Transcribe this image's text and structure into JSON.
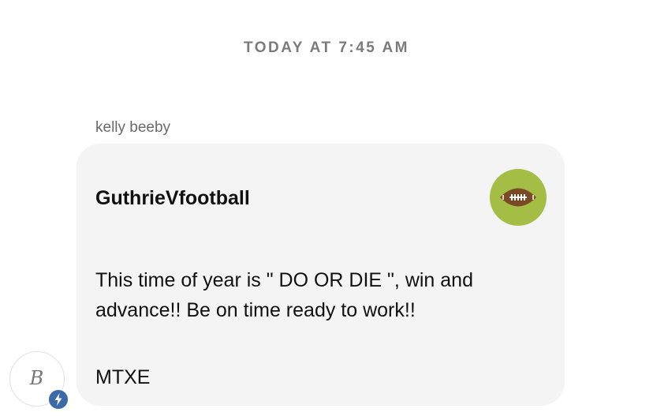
{
  "timestamp": "TODAY AT 7:45 AM",
  "message": {
    "sender": "kelly beeby",
    "group_name": "GuthrieVfootball",
    "group_avatar_icon": "football-icon",
    "group_avatar_color": "#a3bd45",
    "body": "This time of year is \" DO OR DIE \", win and advance!! Be on time ready to work!!",
    "signoff": "MTXE"
  },
  "user_avatar": {
    "initial": "B",
    "badge_icon": "lightning-bolt-icon",
    "badge_color": "#3c6aa8"
  }
}
